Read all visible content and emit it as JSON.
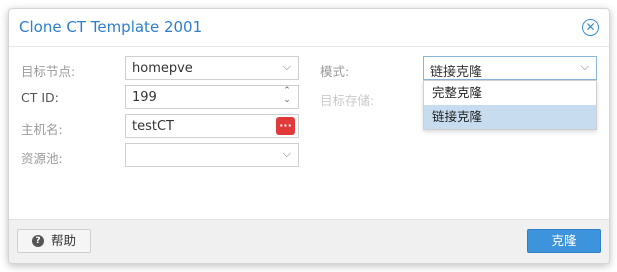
{
  "dialog": {
    "title": "Clone CT Template 2001",
    "close_icon": "close-icon"
  },
  "form": {
    "target_node": {
      "label": "目标节点:",
      "value": "homepve"
    },
    "ct_id": {
      "label": "CT ID:",
      "value": "199"
    },
    "hostname": {
      "label": "主机名:",
      "value": "testCT"
    },
    "pool": {
      "label": "资源池:",
      "value": ""
    },
    "mode": {
      "label": "模式:",
      "value": "链接克隆"
    },
    "target_storage": {
      "label": "目标存储:"
    }
  },
  "mode_options": [
    {
      "label": "完整克隆",
      "selected": false
    },
    {
      "label": "链接克隆",
      "selected": true
    }
  ],
  "footer": {
    "help_label": "帮助",
    "help_icon": "question-icon",
    "clone_label": "克隆"
  },
  "colors": {
    "accent": "#3d93dc",
    "title": "#2c7fcf",
    "selected_option": "#c7dcef",
    "dots_button": "#e03a3a"
  }
}
